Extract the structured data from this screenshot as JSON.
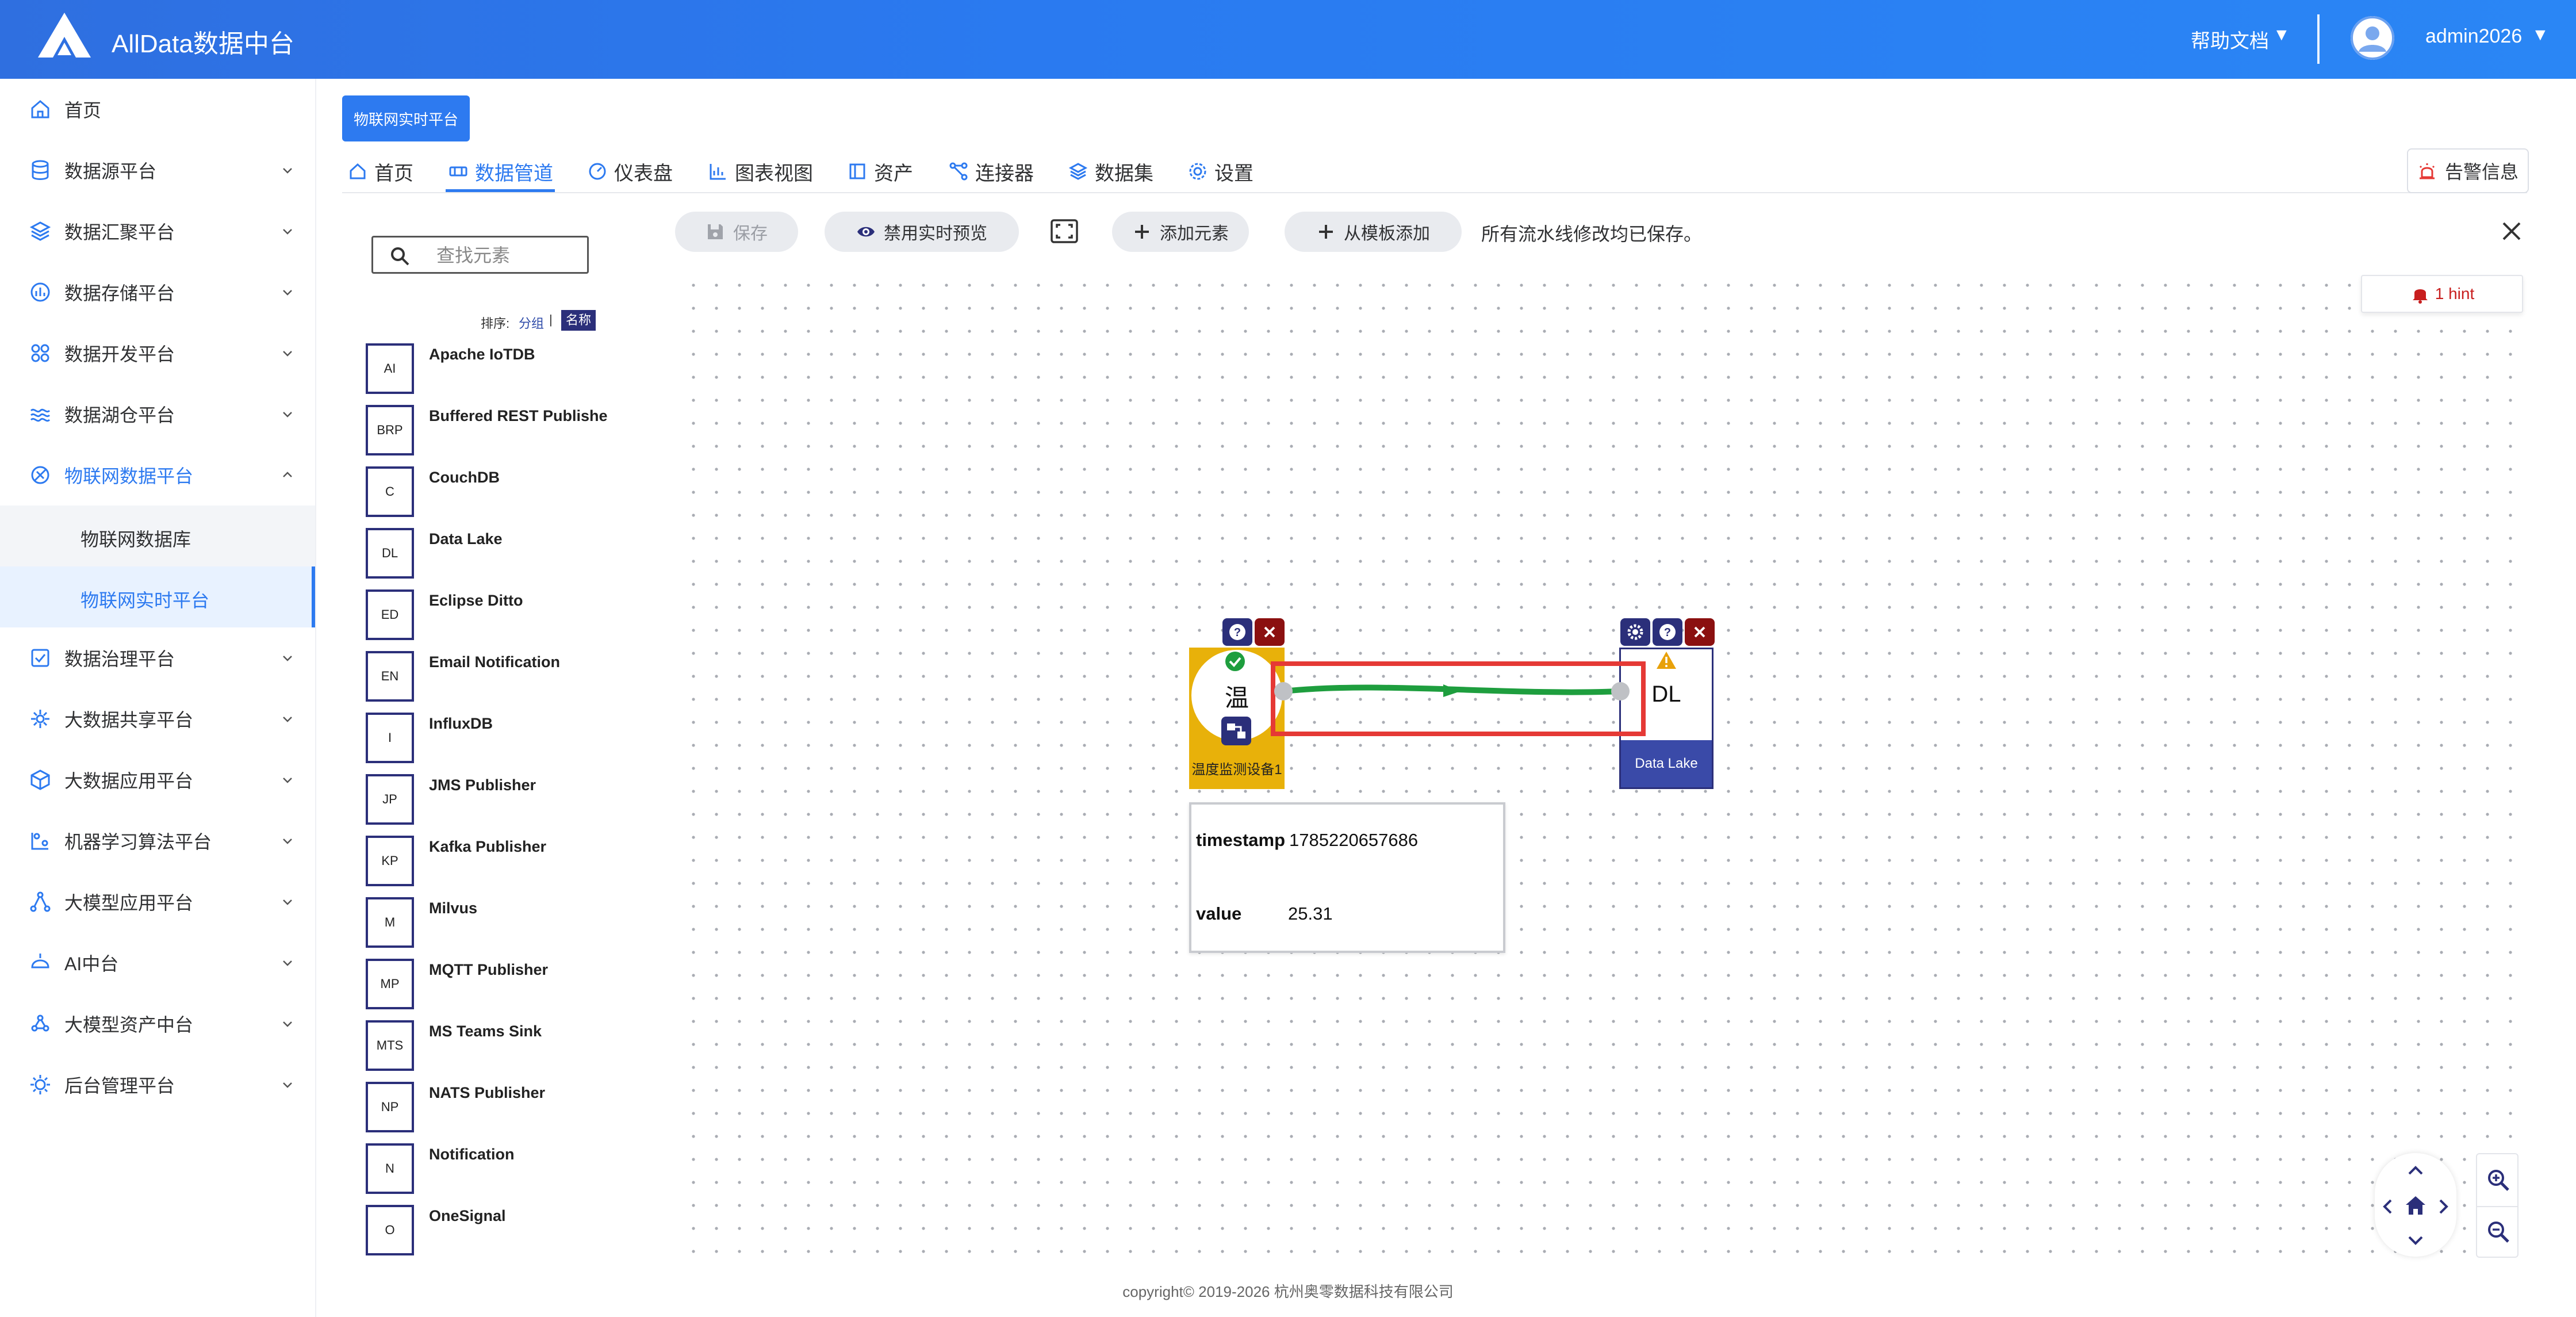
{
  "header": {
    "app_title": "AllData数据中台",
    "help_label": "帮助文档",
    "user_name": "admin2026",
    "dropdown_glyph": "▼"
  },
  "sidebar": {
    "items": [
      {
        "label": "首页",
        "icon": "home-icon"
      },
      {
        "label": "数据源平台",
        "icon": "database-icon"
      },
      {
        "label": "数据汇聚平台",
        "icon": "layers-icon"
      },
      {
        "label": "数据存储平台",
        "icon": "storage-icon"
      },
      {
        "label": "数据开发平台",
        "icon": "grid-icon"
      },
      {
        "label": "数据湖仓平台",
        "icon": "lake-icon"
      },
      {
        "label": "物联网数据平台",
        "icon": "iot-icon"
      },
      {
        "label": "数据治理平台",
        "icon": "governance-icon"
      },
      {
        "label": "大数据共享平台",
        "icon": "share-icon"
      },
      {
        "label": "大数据应用平台",
        "icon": "cube-icon"
      },
      {
        "label": "机器学习算法平台",
        "icon": "ml-icon"
      },
      {
        "label": "大模型应用平台",
        "icon": "model-app-icon"
      },
      {
        "label": "AI中台",
        "icon": "ai-icon"
      },
      {
        "label": "大模型资产中台",
        "icon": "model-asset-icon"
      },
      {
        "label": "后台管理平台",
        "icon": "admin-icon"
      }
    ],
    "sub_items": [
      {
        "label": "物联网数据库"
      },
      {
        "label": "物联网实时平台"
      }
    ]
  },
  "breadcrumb": {
    "label": "物联网实时平台"
  },
  "tabs": [
    {
      "label": "首页",
      "icon": "home-icon"
    },
    {
      "label": "数据管道",
      "icon": "pipeline-icon",
      "active": true
    },
    {
      "label": "仪表盘",
      "icon": "dashboard-icon"
    },
    {
      "label": "图表视图",
      "icon": "chart-icon"
    },
    {
      "label": "资产",
      "icon": "asset-icon"
    },
    {
      "label": "连接器",
      "icon": "connector-icon"
    },
    {
      "label": "数据集",
      "icon": "dataset-icon"
    },
    {
      "label": "设置",
      "icon": "gear-icon"
    }
  ],
  "alarm_button": {
    "label": "告警信息"
  },
  "palette": {
    "search_placeholder": "查找元素",
    "sort_label": "排序:",
    "sort_group": "分组",
    "sort_separator": "|",
    "sort_name": "名称",
    "elements": [
      {
        "abbr": "AI",
        "name": "Apache IoTDB"
      },
      {
        "abbr": "BRP",
        "name": "Buffered REST Publisher"
      },
      {
        "abbr": "C",
        "name": "CouchDB"
      },
      {
        "abbr": "DL",
        "name": "Data Lake"
      },
      {
        "abbr": "ED",
        "name": "Eclipse Ditto"
      },
      {
        "abbr": "EN",
        "name": "Email Notification"
      },
      {
        "abbr": "I",
        "name": "InfluxDB"
      },
      {
        "abbr": "JP",
        "name": "JMS Publisher"
      },
      {
        "abbr": "KP",
        "name": "Kafka Publisher"
      },
      {
        "abbr": "M",
        "name": "Milvus"
      },
      {
        "abbr": "MP",
        "name": "MQTT Publisher"
      },
      {
        "abbr": "MTS",
        "name": "MS Teams Sink"
      },
      {
        "abbr": "NP",
        "name": "NATS Publisher"
      },
      {
        "abbr": "N",
        "name": "Notification"
      },
      {
        "abbr": "O",
        "name": "OneSignal"
      }
    ]
  },
  "toolbar": {
    "save_label": "保存",
    "preview_label": "禁用实时预览",
    "add_element_label": "添加元素",
    "add_template_label": "从模板添加",
    "status_text": "所有流水线修改均已保存。"
  },
  "canvas": {
    "hint_text": "1 hint",
    "source_node": {
      "char": "温",
      "label": "温度监测设备1"
    },
    "sink_node": {
      "abbr": "DL",
      "label": "Data Lake"
    },
    "preview": [
      {
        "key": "timestamp",
        "value": "1785220657686"
      },
      {
        "key": "value",
        "value": "25.31"
      }
    ]
  },
  "colors": {
    "primary": "#2d7af0",
    "node_source": "#e8b10a",
    "node_sink": "#3a4aa8",
    "edge": "#1e9e3e",
    "highlight": "#e53935"
  },
  "footer": {
    "text": "copyright© 2019-2026 杭州奥零数据科技有限公司"
  }
}
